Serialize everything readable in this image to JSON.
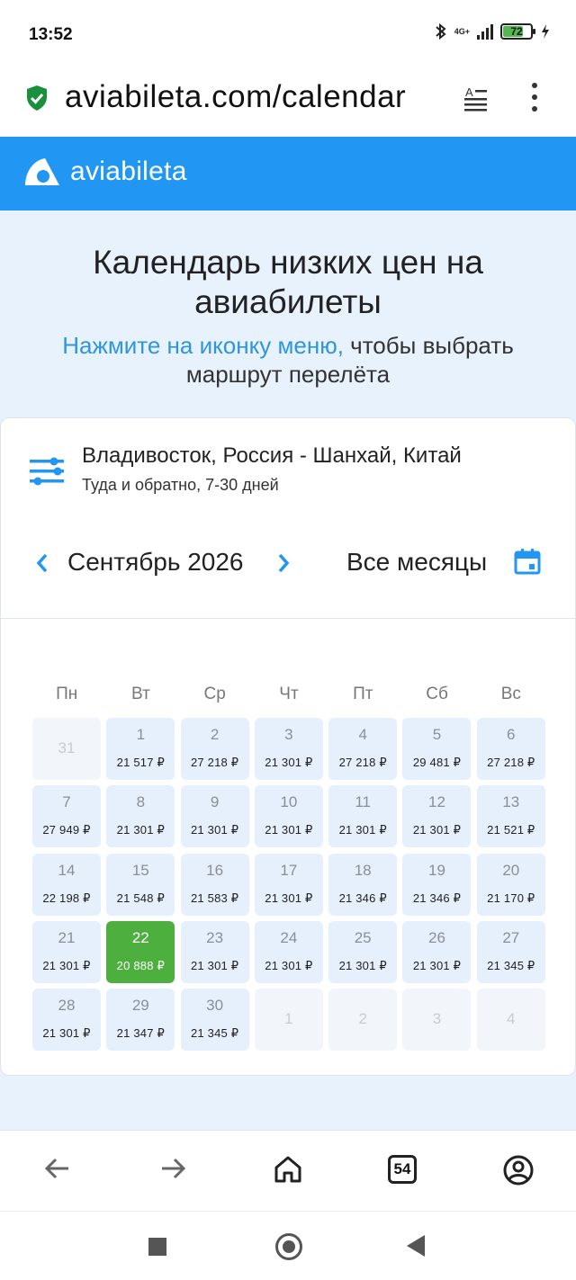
{
  "status": {
    "time": "13:52",
    "network": "4G+",
    "battery": "72"
  },
  "browser": {
    "url": "aviabileta.com/calendar",
    "tabs_count": "54"
  },
  "site": {
    "logo": "aviabileta"
  },
  "hero": {
    "title": "Календарь низких цен на авиабилеты",
    "hint_link": "Нажмите на иконку меню,",
    "hint_rest": " чтобы выбрать маршрут перелёта"
  },
  "search": {
    "route": "Владивосток, Россия - Шанхай, Китай",
    "trip": "Туда и обратно, 7-30 дней"
  },
  "month_nav": {
    "month": "Сентябрь 2026",
    "all_months": "Все месяцы"
  },
  "weekdays": [
    "Пн",
    "Вт",
    "Ср",
    "Чт",
    "Пт",
    "Сб",
    "Вс"
  ],
  "calendar": [
    {
      "day": "31",
      "price": "",
      "state": "off"
    },
    {
      "day": "1",
      "price": "21 517 ₽",
      "state": "on"
    },
    {
      "day": "2",
      "price": "27 218 ₽",
      "state": "on"
    },
    {
      "day": "3",
      "price": "21 301 ₽",
      "state": "on"
    },
    {
      "day": "4",
      "price": "27 218 ₽",
      "state": "on"
    },
    {
      "day": "5",
      "price": "29 481 ₽",
      "state": "on"
    },
    {
      "day": "6",
      "price": "27 218 ₽",
      "state": "on"
    },
    {
      "day": "7",
      "price": "27 949 ₽",
      "state": "on"
    },
    {
      "day": "8",
      "price": "21 301 ₽",
      "state": "on"
    },
    {
      "day": "9",
      "price": "21 301 ₽",
      "state": "on"
    },
    {
      "day": "10",
      "price": "21 301 ₽",
      "state": "on"
    },
    {
      "day": "11",
      "price": "21 301 ₽",
      "state": "on"
    },
    {
      "day": "12",
      "price": "21 301 ₽",
      "state": "on"
    },
    {
      "day": "13",
      "price": "21 521 ₽",
      "state": "on"
    },
    {
      "day": "14",
      "price": "22 198 ₽",
      "state": "on"
    },
    {
      "day": "15",
      "price": "21 548 ₽",
      "state": "on"
    },
    {
      "day": "16",
      "price": "21 583 ₽",
      "state": "on"
    },
    {
      "day": "17",
      "price": "21 301 ₽",
      "state": "on"
    },
    {
      "day": "18",
      "price": "21 346 ₽",
      "state": "on"
    },
    {
      "day": "19",
      "price": "21 346 ₽",
      "state": "on"
    },
    {
      "day": "20",
      "price": "21 170 ₽",
      "state": "on"
    },
    {
      "day": "21",
      "price": "21 301 ₽",
      "state": "on"
    },
    {
      "day": "22",
      "price": "20 888 ₽",
      "state": "sel"
    },
    {
      "day": "23",
      "price": "21 301 ₽",
      "state": "on"
    },
    {
      "day": "24",
      "price": "21 301 ₽",
      "state": "on"
    },
    {
      "day": "25",
      "price": "21 301 ₽",
      "state": "on"
    },
    {
      "day": "26",
      "price": "21 301 ₽",
      "state": "on"
    },
    {
      "day": "27",
      "price": "21 345 ₽",
      "state": "on"
    },
    {
      "day": "28",
      "price": "21 301 ₽",
      "state": "on"
    },
    {
      "day": "29",
      "price": "21 347 ₽",
      "state": "on"
    },
    {
      "day": "30",
      "price": "21 345 ₽",
      "state": "on"
    },
    {
      "day": "1",
      "price": "",
      "state": "off"
    },
    {
      "day": "2",
      "price": "",
      "state": "off"
    },
    {
      "day": "3",
      "price": "",
      "state": "off"
    },
    {
      "day": "4",
      "price": "",
      "state": "off"
    }
  ],
  "colors": {
    "brand": "#2196f3",
    "selected": "#4caf3e",
    "cell": "#e6f0fc",
    "hero_bg": "#e8f2fd"
  },
  "icons": [
    "shield-check-icon",
    "reader-mode-icon",
    "more-vert-icon",
    "logo-icon",
    "filter-sliders-icon",
    "chevron-left-icon",
    "chevron-right-icon",
    "calendar-icon",
    "back-arrow-icon",
    "forward-arrow-icon",
    "home-icon",
    "account-icon"
  ]
}
